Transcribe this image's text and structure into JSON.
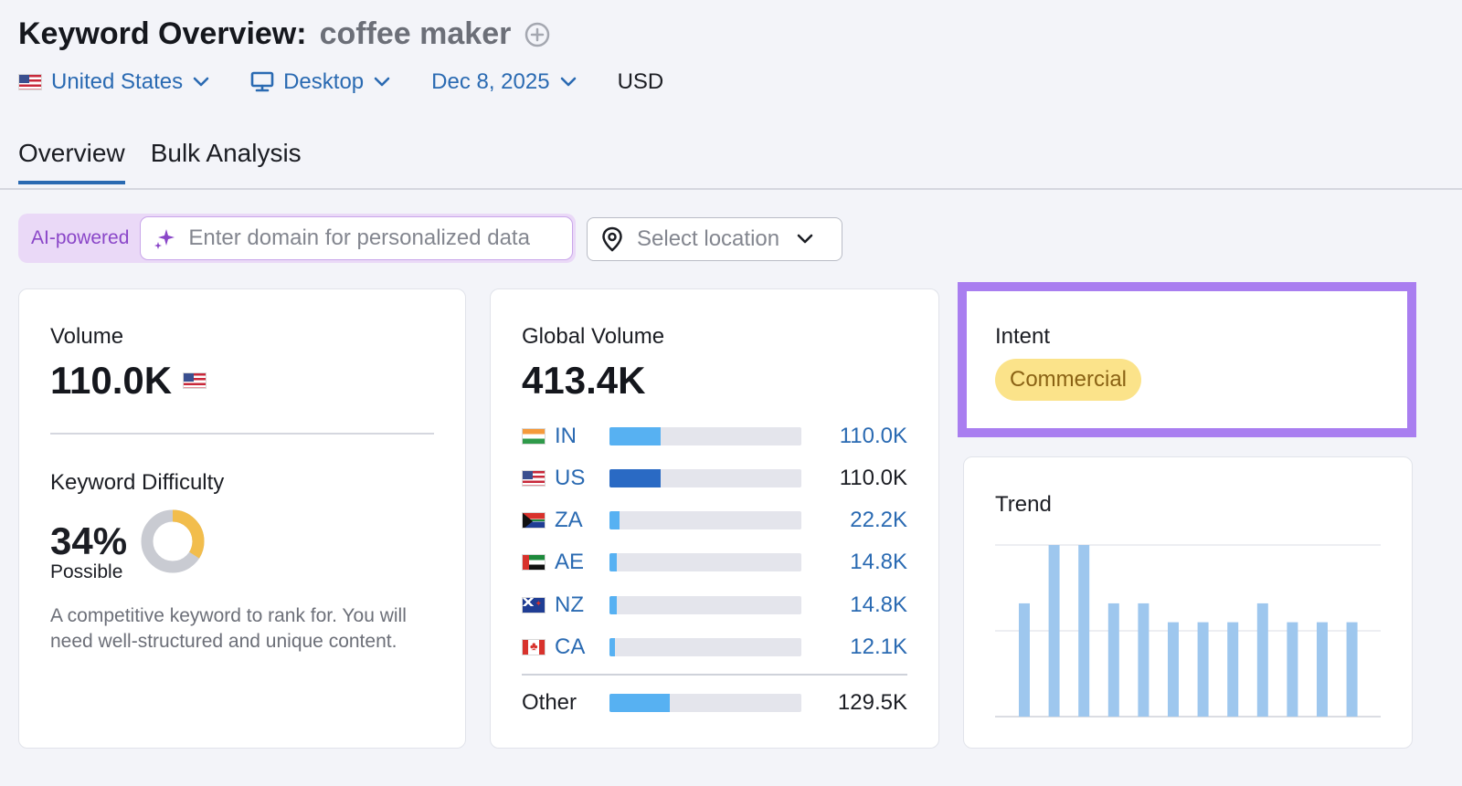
{
  "header": {
    "title_prefix": "Keyword Overview:",
    "keyword": "coffee maker",
    "add_icon": "plus-circle-icon"
  },
  "filters": {
    "country": "United States",
    "device": "Desktop",
    "date": "Dec 8, 2025",
    "currency": "USD"
  },
  "tabs": [
    {
      "label": "Overview",
      "active": true
    },
    {
      "label": "Bulk Analysis",
      "active": false
    }
  ],
  "ai": {
    "badge": "AI-powered",
    "placeholder": "Enter domain for personalized data",
    "icon": "sparkle-icon"
  },
  "location": {
    "placeholder": "Select location",
    "icon": "map-pin-icon"
  },
  "volume": {
    "label": "Volume",
    "value": "110.0K",
    "country_flag": "us"
  },
  "keyword_difficulty": {
    "label": "Keyword Difficulty",
    "value": "34%",
    "percent": 34,
    "level": "Possible",
    "description": "A competitive keyword to rank for. You will need well-structured and unique content.",
    "ring_color": "#f2bd4c",
    "ring_track_color": "#c9cbd2"
  },
  "global_volume": {
    "label": "Global Volume",
    "value": "413.4K",
    "countries": [
      {
        "code": "IN",
        "flag": "in",
        "value": "110.0K",
        "share": 0.266,
        "highlight": false
      },
      {
        "code": "US",
        "flag": "us",
        "value": "110.0K",
        "share": 0.266,
        "highlight": true
      },
      {
        "code": "ZA",
        "flag": "za",
        "value": "22.2K",
        "share": 0.054,
        "highlight": false
      },
      {
        "code": "AE",
        "flag": "ae",
        "value": "14.8K",
        "share": 0.036,
        "highlight": false
      },
      {
        "code": "NZ",
        "flag": "nz",
        "value": "14.8K",
        "share": 0.036,
        "highlight": false
      },
      {
        "code": "CA",
        "flag": "ca",
        "value": "12.1K",
        "share": 0.029,
        "highlight": false
      }
    ],
    "other": {
      "label": "Other",
      "value": "129.5K",
      "share": 0.313
    },
    "bar_color": "#57b1f2",
    "highlight_bar_color": "#2a6ac4"
  },
  "intent": {
    "label": "Intent",
    "value": "Commercial",
    "highlight_color": "#a97ef0"
  },
  "trend": {
    "label": "Trend",
    "bar_color": "#9ec7ee",
    "values": [
      0.66,
      1.0,
      1.0,
      0.66,
      0.66,
      0.55,
      0.55,
      0.55,
      0.66,
      0.55,
      0.55,
      0.55
    ]
  }
}
